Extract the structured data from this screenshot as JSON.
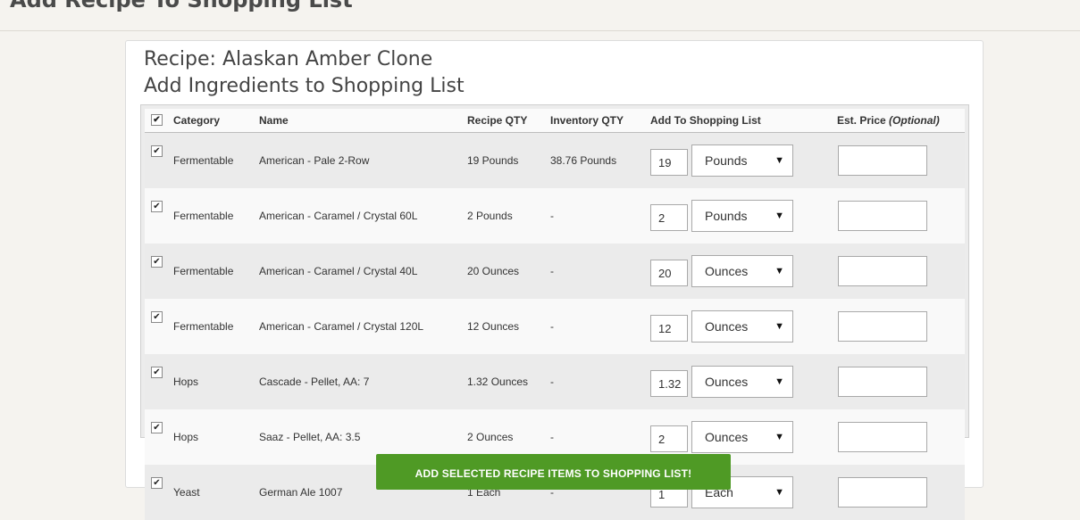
{
  "page": {
    "title": "Add Recipe To Shopping List"
  },
  "recipe": {
    "heading": "Recipe: Alaskan Amber Clone",
    "subheading": "Add Ingredients to Shopping List"
  },
  "table": {
    "headers": {
      "category": "Category",
      "name": "Name",
      "recipe_qty": "Recipe QTY",
      "inventory_qty": "Inventory QTY",
      "add_to_list": "Add To Shopping List",
      "price": "Est. Price",
      "price_note": "(Optional)"
    },
    "rows": [
      {
        "checked": true,
        "category": "Fermentable",
        "name": "American - Pale 2-Row",
        "recipe_qty": "19 Pounds",
        "inventory_qty": "38.76 Pounds",
        "qty": "19",
        "unit": "Pounds",
        "price": ""
      },
      {
        "checked": true,
        "category": "Fermentable",
        "name": "American - Caramel / Crystal 60L",
        "recipe_qty": "2 Pounds",
        "inventory_qty": "-",
        "qty": "2",
        "unit": "Pounds",
        "price": ""
      },
      {
        "checked": true,
        "category": "Fermentable",
        "name": "American - Caramel / Crystal 40L",
        "recipe_qty": "20 Ounces",
        "inventory_qty": "-",
        "qty": "20",
        "unit": "Ounces",
        "price": ""
      },
      {
        "checked": true,
        "category": "Fermentable",
        "name": "American - Caramel / Crystal 120L",
        "recipe_qty": "12 Ounces",
        "inventory_qty": "-",
        "qty": "12",
        "unit": "Ounces",
        "price": ""
      },
      {
        "checked": true,
        "category": "Hops",
        "name": "Cascade - Pellet, AA: 7",
        "recipe_qty": "1.32 Ounces",
        "inventory_qty": "-",
        "qty": "1.32",
        "unit": "Ounces",
        "price": ""
      },
      {
        "checked": true,
        "category": "Hops",
        "name": "Saaz - Pellet, AA: 3.5",
        "recipe_qty": "2 Ounces",
        "inventory_qty": "-",
        "qty": "2",
        "unit": "Ounces",
        "price": ""
      },
      {
        "checked": true,
        "category": "Yeast",
        "name": "German Ale 1007",
        "recipe_qty": "1 Each",
        "inventory_qty": "-",
        "qty": "1",
        "unit": "Each",
        "price": ""
      }
    ]
  },
  "actions": {
    "submit_label": "ADD SELECTED RECIPE ITEMS TO SHOPPING LIST!"
  },
  "colors": {
    "accent": "#4f9a25",
    "background": "#f5f3ef"
  }
}
